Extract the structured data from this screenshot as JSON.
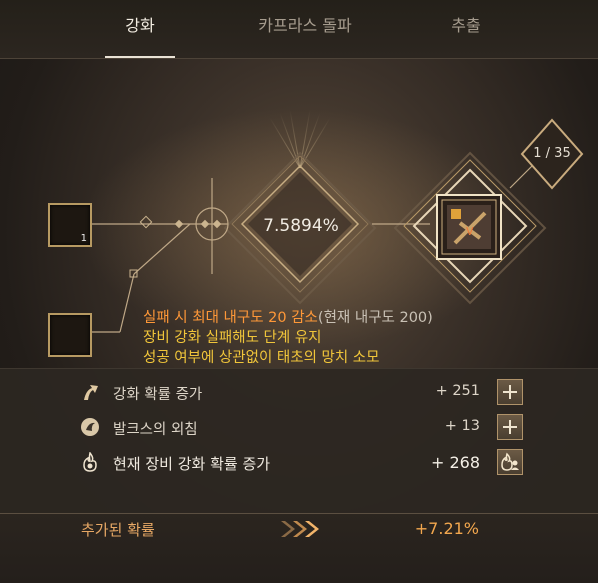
{
  "tabs": [
    {
      "label": "강화",
      "active": true
    },
    {
      "label": "카프라스 돌파",
      "active": false
    },
    {
      "label": "추출",
      "active": false
    }
  ],
  "diagram": {
    "probability": "7.5894%",
    "counter": "1 / 35",
    "material_slot_top": {
      "icon": "orb-icon",
      "quantity": "1"
    },
    "material_slot_bottom": {
      "icon": "hammer-icon"
    },
    "target_slot": {
      "icon": "crossbow-icon"
    }
  },
  "info": {
    "line1_main": "실패 시 최대 내구도 20 감소",
    "line1_sub": "(현재 내구도 200)",
    "line2": "장비 강화 실패해도 단계 유지",
    "line3": "성공 여부에 상관없이 태초의 망치 소모"
  },
  "rows": [
    {
      "icon": "arrow-up-icon",
      "label": "강화 확률 증가",
      "value": "+ 251",
      "button": "plus"
    },
    {
      "icon": "moon-icon",
      "label": "발크스의 외침",
      "value": "+ 13",
      "button": "plus"
    },
    {
      "icon": "flame-icon",
      "label": "현재 장비 강화 확률 증가",
      "value": "+ 268",
      "button": "flame-person"
    }
  ],
  "total": {
    "label": "추가된 확률",
    "value": "+7.21%"
  },
  "colors": {
    "accent": "#f2a74e",
    "warning": "#ff9838",
    "yellow": "#f0c53a",
    "gold": "#b79a62"
  }
}
